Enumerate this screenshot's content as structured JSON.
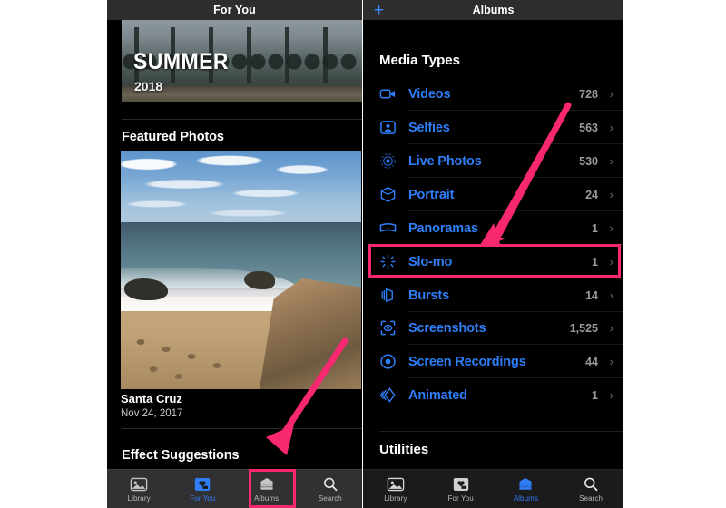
{
  "left_phone": {
    "nav_title": "For You",
    "memory": {
      "title": "SUMMER",
      "year": "2018"
    },
    "featured_header": "Featured Photos",
    "featured_caption_title": "Santa Cruz",
    "featured_caption_date": "Nov 24, 2017",
    "effects_header": "Effect Suggestions",
    "tabs": [
      {
        "label": "Library",
        "icon": "photo-library-icon",
        "active": false
      },
      {
        "label": "For You",
        "icon": "for-you-icon",
        "active": true
      },
      {
        "label": "Albums",
        "icon": "albums-icon",
        "active": false
      },
      {
        "label": "Search",
        "icon": "search-icon",
        "active": false
      }
    ]
  },
  "right_phone": {
    "nav_title": "Albums",
    "add_button": "+",
    "media_types_header": "Media Types",
    "utilities_header": "Utilities",
    "media_types": [
      {
        "label": "Videos",
        "count": "728",
        "icon": "video-camera-icon"
      },
      {
        "label": "Selfies",
        "count": "563",
        "icon": "selfie-person-icon"
      },
      {
        "label": "Live Photos",
        "count": "530",
        "icon": "live-photo-icon"
      },
      {
        "label": "Portrait",
        "count": "24",
        "icon": "portrait-cube-icon"
      },
      {
        "label": "Panoramas",
        "count": "1",
        "icon": "panorama-icon"
      },
      {
        "label": "Slo-mo",
        "count": "1",
        "icon": "slo-mo-icon"
      },
      {
        "label": "Bursts",
        "count": "14",
        "icon": "bursts-stack-icon"
      },
      {
        "label": "Screenshots",
        "count": "1,525",
        "icon": "screenshot-icon"
      },
      {
        "label": "Screen Recordings",
        "count": "44",
        "icon": "screen-recording-icon"
      },
      {
        "label": "Animated",
        "count": "1",
        "icon": "animated-icon"
      }
    ],
    "chevron": "›",
    "tabs": [
      {
        "label": "Library",
        "icon": "photo-library-icon",
        "active": false
      },
      {
        "label": "For You",
        "icon": "for-you-icon",
        "active": false
      },
      {
        "label": "Albums",
        "icon": "albums-icon",
        "active": true
      },
      {
        "label": "Search",
        "icon": "search-icon",
        "active": false
      }
    ]
  },
  "annotations": {
    "highlight_color": "#f7286f",
    "accent_blue": "#2f7ef7",
    "highlights": [
      "slo-mo-row",
      "albums-tab"
    ],
    "arrows": [
      "arrow-to-slo-mo",
      "arrow-to-albums-tab"
    ]
  }
}
